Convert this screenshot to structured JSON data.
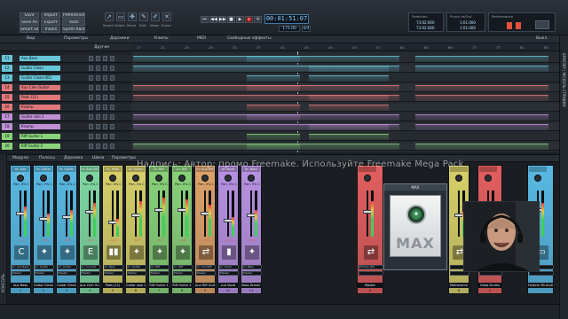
{
  "control_bar": {
    "file_buttons": [
      "Save",
      "Import",
      "Preferences",
      "Save As",
      "Export",
      "Tools",
      "Smart Save",
      "Tracks",
      "Synth Rack",
      "Set Screen",
      "Fit Project",
      "Keyboard"
    ],
    "tools": [
      {
        "label": "Smart",
        "icon": "pointer-icon"
      },
      {
        "label": "Select",
        "icon": "select-icon"
      },
      {
        "label": "Move",
        "icon": "move-icon"
      },
      {
        "label": "Edit",
        "icon": "pencil-icon"
      },
      {
        "label": "Draw",
        "icon": "draw-icon"
      },
      {
        "label": "Erase",
        "icon": "erase-icon"
      }
    ],
    "transport_icons": [
      "rewind-icon",
      "back-icon",
      "forward-icon",
      "stop-icon",
      "play-icon",
      "record-icon",
      "loop-icon"
    ],
    "time": "00:01:51:07",
    "tempo": "175.00",
    "meter": "4/4",
    "selection": {
      "title": "Selection",
      "from": "73:02:000",
      "to": "73:02:000"
    },
    "punch": {
      "title": "Punch In/Out",
      "from": "1:01:000",
      "to": "1:01:000"
    },
    "performance": {
      "title": "Performance"
    }
  },
  "arranger": {
    "menus": [
      "Вид",
      "Параметры",
      "Дорожки",
      "Клипы",
      "MIDI",
      "Свободные эффекты"
    ],
    "right_label": "Выкл.",
    "group_label": "Другие",
    "ruler": [
      "17",
      "21",
      "25",
      "29",
      "33",
      "37",
      "41",
      "45",
      "49",
      "53",
      "57",
      "61",
      "65",
      "69",
      "73",
      "77",
      "81",
      "85"
    ],
    "side_tab": "БРАУЗЕР  |  МОДУЛЬ СПРАВКИ",
    "tracks": [
      {
        "num": "11",
        "name": "Aux Bass",
        "color": "#67c6d8"
      },
      {
        "num": "12",
        "name": "Guitar Clean",
        "color": "#67c6d8"
      },
      {
        "num": "13",
        "name": "Guitar Clean-001",
        "color": "#67c6d8"
      },
      {
        "num": "14",
        "name": "Aux Clen Guitar",
        "color": "#e0787a"
      },
      {
        "num": "15",
        "name": "Pads (12)",
        "color": "#e0787a"
      },
      {
        "num": "16",
        "name": "Клипы",
        "color": "#e0787a"
      },
      {
        "num": "17",
        "name": "Guitar solo 1",
        "color": "#c08fd6"
      },
      {
        "num": "18",
        "name": "Клипы",
        "color": "#c08fd6"
      },
      {
        "num": "19",
        "name": "Riff Guitar 1",
        "color": "#8ad37a"
      },
      {
        "num": "20",
        "name": "Riff Guitar 2",
        "color": "#8ad37a"
      }
    ]
  },
  "console": {
    "menus": [
      "Модули",
      "Полосы",
      "Дорожка",
      "Шина",
      "Параметры"
    ],
    "side_tab": "КОНСОЛЬ",
    "caption": "Надпись: Автор: промо Freemake. Используйте Freemake Mega Pack",
    "strips": [
      {
        "name": "Aux Bass",
        "num": "1",
        "color": "#59b9e3",
        "icon": "C",
        "icon_name": "c-icon",
        "io_in": "In: Aux Bass",
        "io_out": "Master",
        "pan": "Pan: 0% C",
        "db": "-7.1"
      },
      {
        "name": "Guitar Clean",
        "num": "2",
        "color": "#59b9e3",
        "icon": "✦",
        "icon_name": "guitar-icon",
        "io_in": "In: Guitar",
        "io_out": "Master",
        "pan": "Pan: 0% C",
        "db": "-9.4"
      },
      {
        "name": "Guitar Clean-001",
        "num": "3",
        "color": "#59b9e3",
        "icon": "✦",
        "icon_name": "guitar-icon",
        "io_in": "In: Guitar",
        "io_out": "Master",
        "pan": "Pan: 0% C",
        "db": "-8.0"
      },
      {
        "name": "Aux Clen Guitar",
        "num": "4",
        "color": "#7fd9a2",
        "icon": "E",
        "icon_name": "e-icon",
        "io_in": "In: Aux Gtr",
        "io_out": "Master",
        "pan": "Pan: 0% C",
        "db": "-6.2"
      },
      {
        "name": "Pads (12)",
        "num": "5",
        "color": "#d7d06a",
        "icon": "▮▮",
        "icon_name": "piano-icon",
        "io_in": "In: Pads",
        "io_out": "Master",
        "pan": "Pan: 0% C",
        "db": "-12.3"
      },
      {
        "name": "Guitar solo 1",
        "num": "6",
        "color": "#d7d06a",
        "icon": "✦",
        "icon_name": "guitar-icon",
        "io_in": "In: Guitar",
        "io_out": "Master",
        "pan": "Pan: 0% C",
        "db": "-5.7"
      },
      {
        "name": "Riff Guitar 1",
        "num": "7",
        "color": "#8ad37a",
        "icon": "✦",
        "icon_name": "guitar-icon",
        "io_in": "In: Riff",
        "io_out": "Master",
        "pan": "Pan: 0% C",
        "db": "-4.1"
      },
      {
        "name": "Riff Guitar 2",
        "num": "8",
        "color": "#8ad37a",
        "icon": "✦",
        "icon_name": "guitar-icon",
        "io_in": "In: Riff",
        "io_out": "Master",
        "pan": "Pan: 0% C",
        "db": "-4.6"
      },
      {
        "name": "Aux Riff Guitar",
        "num": "9",
        "color": "#e0a36b",
        "icon": "⇄",
        "icon_name": "aux-icon",
        "io_in": "In: Aux Riff",
        "io_out": "Master",
        "pan": "Pan: 0% C",
        "db": "-3.3"
      },
      {
        "name": "Lnd Vocal",
        "num": "10",
        "color": "#b892e3",
        "icon": "▮",
        "icon_name": "vocal-icon",
        "io_in": "In: Vocal",
        "io_out": "Master",
        "pan": "Pan: 0% C",
        "db": "-10.2"
      },
      {
        "name": "Bass Drover",
        "num": "11",
        "color": "#b892e3",
        "icon": "✦",
        "icon_name": "bass-icon",
        "io_in": "In: Bass",
        "io_out": "Master",
        "pan": "Pan: 0% C",
        "db": "-6.6"
      }
    ],
    "master": {
      "name": "Master",
      "num": "A",
      "color": "#e25e5e",
      "icon": "⇄",
      "icon_name": "master-icon",
      "io": "Phones (Hi)"
    },
    "metronome": {
      "name": "Metronome",
      "num": "B",
      "color": "#d7d06a",
      "icon": "⇄",
      "icon_name": "metronome-icon"
    },
    "drums": {
      "name": "Glass Drums",
      "num": "C",
      "color": "#e25e5e",
      "icon": "▲",
      "icon_name": "drums-icon"
    },
    "output": {
      "name": "Fantom 3B Audio",
      "color": "#59b9e3",
      "icon": "▭",
      "icon_name": "output-icon"
    },
    "plugin": {
      "title": "MAX",
      "logo": "MAX"
    }
  }
}
